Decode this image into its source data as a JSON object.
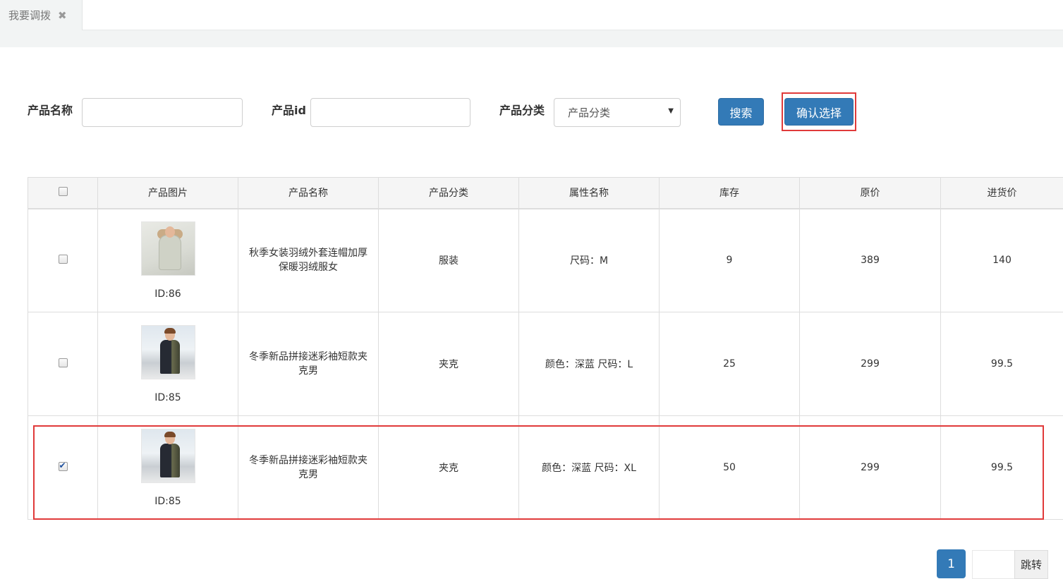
{
  "tabs": [
    {
      "label": "我要调拨",
      "close_icon": "close-icon"
    }
  ],
  "search": {
    "name_label": "产品名称",
    "name_value": "",
    "id_label": "产品id",
    "id_value": "",
    "category_label": "产品分类",
    "category_selected": "产品分类",
    "search_button": "搜索",
    "confirm_button": "确认选择"
  },
  "table": {
    "columns": [
      "产品图片",
      "产品名称",
      "产品分类",
      "属性名称",
      "库存",
      "原价",
      "进货价"
    ],
    "rows": [
      {
        "checked": false,
        "image": "女款羽绒服图片",
        "id_label": "ID:86",
        "name": "秋季女装羽绒外套连帽加厚保暖羽绒服女",
        "category": "服装",
        "attributes": "尺码：M",
        "stock": "9",
        "price": "389",
        "cost": "140"
      },
      {
        "checked": false,
        "image": "男款夹克图片",
        "id_label": "ID:85",
        "name": "冬季新品拼接迷彩袖短款夹克男",
        "category": "夹克",
        "attributes": "颜色：深蓝 尺码：L",
        "stock": "25",
        "price": "299",
        "cost": "99.5"
      },
      {
        "checked": true,
        "image": "男款夹克图片",
        "id_label": "ID:85",
        "name": "冬季新品拼接迷彩袖短款夹克男",
        "category": "夹克",
        "attributes": "颜色：深蓝 尺码：XL",
        "stock": "50",
        "price": "299",
        "cost": "99.5"
      }
    ]
  },
  "pagination": {
    "current_page": "1",
    "jump_value": "",
    "jump_button": "跳转"
  },
  "colors": {
    "primary": "#337ab7",
    "annotation": "#e03a3a"
  }
}
